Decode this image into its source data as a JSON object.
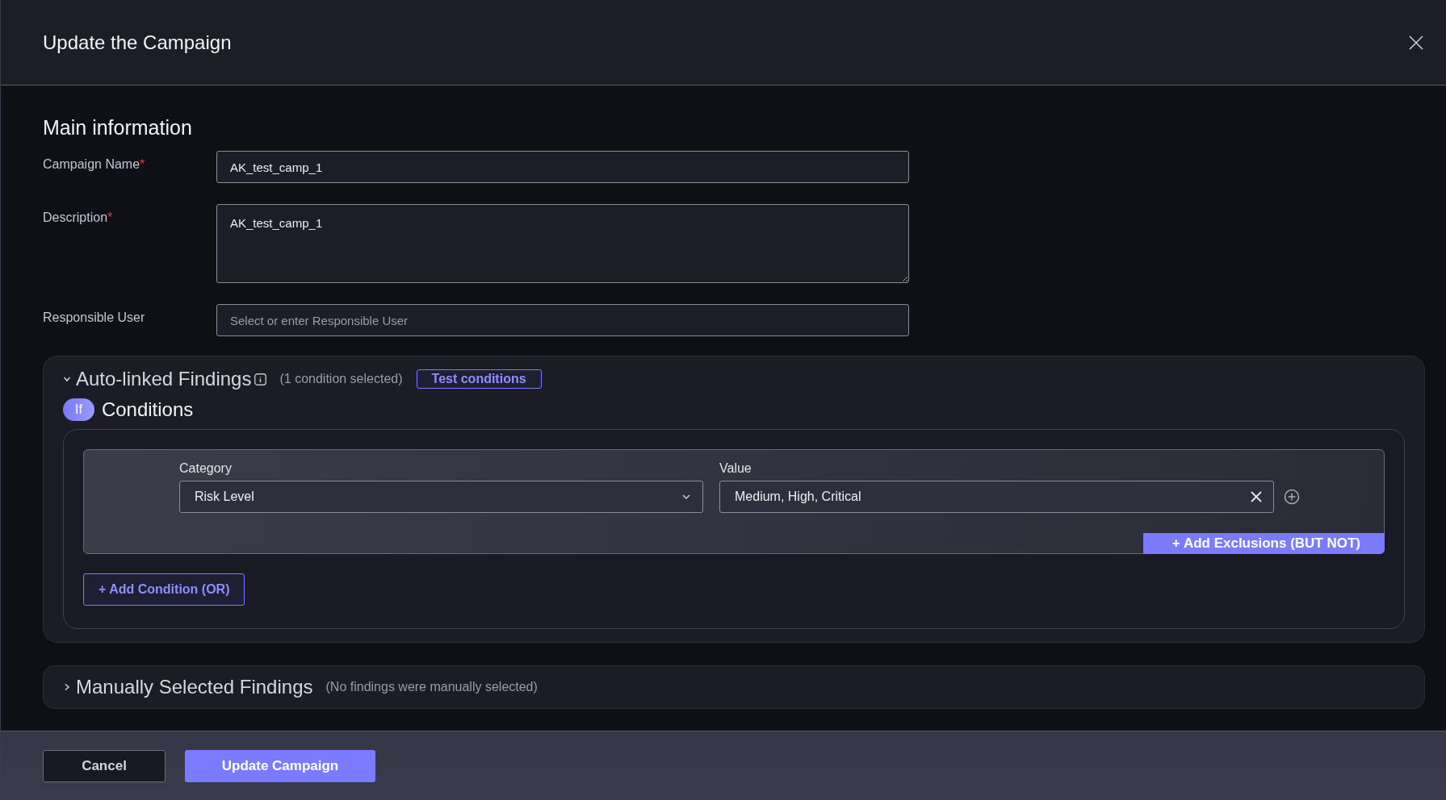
{
  "dialog": {
    "title": "Update the Campaign"
  },
  "main_information": {
    "heading": "Main information",
    "fields": [
      {
        "kind": "input",
        "label": "Campaign Name",
        "required_mark": "*",
        "value": "AK_test_camp_1"
      },
      {
        "kind": "textarea",
        "label": "Description",
        "required_mark": "*",
        "value": "AK_test_camp_1"
      },
      {
        "kind": "input",
        "label": "Responsible User",
        "placeholder": "Select or enter Responsible User"
      }
    ]
  },
  "auto_linked_findings": {
    "title": "Auto-linked Findings",
    "expanded": true,
    "summary": "(1 condition selected)",
    "test_button": "Test conditions",
    "if_badge": "If",
    "conditions_heading": "Conditions",
    "conditions": [
      {
        "category_label": "Category",
        "category": "Risk Level",
        "value_label": "Value",
        "value": "Medium, High, Critical",
        "exclusions_button": "+ Add Exclusions (BUT NOT)"
      }
    ],
    "add_condition_button": "+ Add Condition (OR)"
  },
  "manually_selected_findings": {
    "title": "Manually Selected Findings",
    "expanded": false,
    "summary": "(No findings were manually selected)"
  },
  "footer": {
    "cancel": "Cancel",
    "submit": "Update Campaign"
  }
}
